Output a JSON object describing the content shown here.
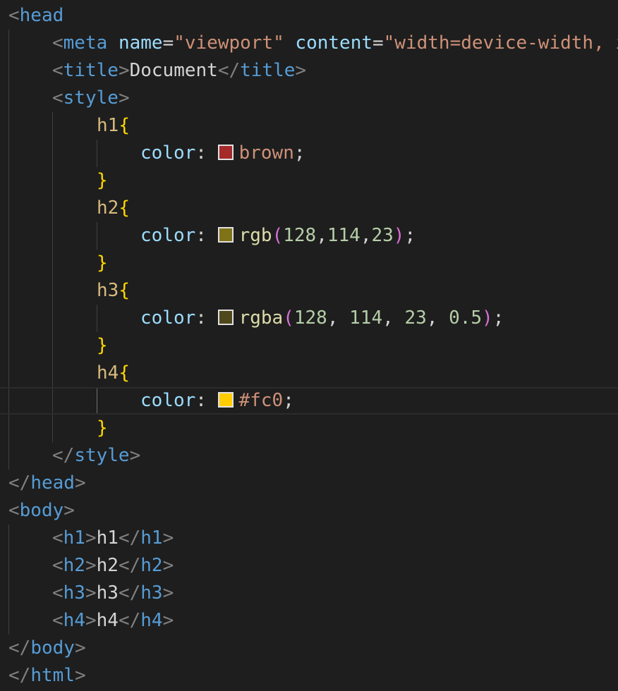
{
  "editor": {
    "lines": [
      {
        "indent": 0,
        "tokens": [
          {
            "t": "<",
            "c": "punct"
          },
          {
            "t": "head",
            "c": "tag"
          }
        ]
      },
      {
        "indent": 4,
        "tokens": [
          {
            "t": "<",
            "c": "punct"
          },
          {
            "t": "meta",
            "c": "tag"
          },
          {
            "t": " ",
            "c": "text"
          },
          {
            "t": "name",
            "c": "attr"
          },
          {
            "t": "=",
            "c": "eq"
          },
          {
            "t": "\"viewport\"",
            "c": "str"
          },
          {
            "t": " ",
            "c": "text"
          },
          {
            "t": "content",
            "c": "attr"
          },
          {
            "t": "=",
            "c": "eq"
          },
          {
            "t": "\"width=device-width, i",
            "c": "str"
          }
        ]
      },
      {
        "indent": 4,
        "tokens": [
          {
            "t": "<",
            "c": "punct"
          },
          {
            "t": "title",
            "c": "tag"
          },
          {
            "t": ">",
            "c": "punct"
          },
          {
            "t": "Document",
            "c": "text"
          },
          {
            "t": "</",
            "c": "punct"
          },
          {
            "t": "title",
            "c": "tag"
          },
          {
            "t": ">",
            "c": "punct"
          }
        ]
      },
      {
        "indent": 4,
        "tokens": [
          {
            "t": "<",
            "c": "punct"
          },
          {
            "t": "style",
            "c": "tag"
          },
          {
            "t": ">",
            "c": "punct"
          }
        ]
      },
      {
        "indent": 8,
        "tokens": [
          {
            "t": "h1",
            "c": "sel"
          },
          {
            "t": "{",
            "c": "brace"
          }
        ]
      },
      {
        "indent": 12,
        "tokens": [
          {
            "t": "color",
            "c": "prop"
          },
          {
            "t": ": ",
            "c": "text"
          },
          {
            "t": "",
            "c": "swatch",
            "color": "#a52a2a"
          },
          {
            "t": "brown",
            "c": "val"
          },
          {
            "t": ";",
            "c": "text"
          }
        ]
      },
      {
        "indent": 8,
        "tokens": [
          {
            "t": "}",
            "c": "brace"
          }
        ]
      },
      {
        "indent": 8,
        "tokens": [
          {
            "t": "h2",
            "c": "sel"
          },
          {
            "t": "{",
            "c": "brace"
          }
        ]
      },
      {
        "indent": 12,
        "tokens": [
          {
            "t": "color",
            "c": "prop"
          },
          {
            "t": ": ",
            "c": "text"
          },
          {
            "t": "",
            "c": "swatch",
            "color": "#807217"
          },
          {
            "t": "rgb",
            "c": "fn"
          },
          {
            "t": "(",
            "c": "paren"
          },
          {
            "t": "128",
            "c": "num"
          },
          {
            "t": ",",
            "c": "text"
          },
          {
            "t": "114",
            "c": "num"
          },
          {
            "t": ",",
            "c": "text"
          },
          {
            "t": "23",
            "c": "num"
          },
          {
            "t": ")",
            "c": "paren"
          },
          {
            "t": ";",
            "c": "text"
          }
        ]
      },
      {
        "indent": 8,
        "tokens": [
          {
            "t": "}",
            "c": "brace"
          }
        ]
      },
      {
        "indent": 8,
        "tokens": [
          {
            "t": "h3",
            "c": "sel"
          },
          {
            "t": "{",
            "c": "brace"
          }
        ]
      },
      {
        "indent": 12,
        "tokens": [
          {
            "t": "color",
            "c": "prop"
          },
          {
            "t": ": ",
            "c": "text"
          },
          {
            "t": "",
            "c": "swatch",
            "color": "#4f481a"
          },
          {
            "t": "rgba",
            "c": "fn"
          },
          {
            "t": "(",
            "c": "paren"
          },
          {
            "t": "128",
            "c": "num"
          },
          {
            "t": ", ",
            "c": "text"
          },
          {
            "t": "114",
            "c": "num"
          },
          {
            "t": ", ",
            "c": "text"
          },
          {
            "t": "23",
            "c": "num"
          },
          {
            "t": ", ",
            "c": "text"
          },
          {
            "t": "0.5",
            "c": "num"
          },
          {
            "t": ")",
            "c": "paren"
          },
          {
            "t": ";",
            "c": "text"
          }
        ]
      },
      {
        "indent": 8,
        "tokens": [
          {
            "t": "}",
            "c": "brace"
          }
        ]
      },
      {
        "indent": 8,
        "tokens": [
          {
            "t": "h4",
            "c": "sel"
          },
          {
            "t": "{",
            "c": "brace"
          }
        ]
      },
      {
        "indent": 12,
        "tokens": [
          {
            "t": "color",
            "c": "prop"
          },
          {
            "t": ": ",
            "c": "text"
          },
          {
            "t": "",
            "c": "swatch",
            "color": "#ffcc00"
          },
          {
            "t": "#fc0",
            "c": "val"
          },
          {
            "t": ";",
            "c": "text"
          }
        ],
        "current": true
      },
      {
        "indent": 8,
        "tokens": [
          {
            "t": "}",
            "c": "brace"
          }
        ]
      },
      {
        "indent": 4,
        "tokens": [
          {
            "t": "</",
            "c": "punct"
          },
          {
            "t": "style",
            "c": "tag"
          },
          {
            "t": ">",
            "c": "punct"
          }
        ]
      },
      {
        "indent": 0,
        "tokens": [
          {
            "t": "</",
            "c": "punct"
          },
          {
            "t": "head",
            "c": "tag"
          },
          {
            "t": ">",
            "c": "punct"
          }
        ]
      },
      {
        "indent": 0,
        "tokens": [
          {
            "t": "<",
            "c": "punct"
          },
          {
            "t": "body",
            "c": "tag"
          },
          {
            "t": ">",
            "c": "punct"
          }
        ]
      },
      {
        "indent": 4,
        "tokens": [
          {
            "t": "<",
            "c": "punct"
          },
          {
            "t": "h1",
            "c": "tag"
          },
          {
            "t": ">",
            "c": "punct"
          },
          {
            "t": "h1",
            "c": "text"
          },
          {
            "t": "</",
            "c": "punct"
          },
          {
            "t": "h1",
            "c": "tag"
          },
          {
            "t": ">",
            "c": "punct"
          }
        ]
      },
      {
        "indent": 4,
        "tokens": [
          {
            "t": "<",
            "c": "punct"
          },
          {
            "t": "h2",
            "c": "tag"
          },
          {
            "t": ">",
            "c": "punct"
          },
          {
            "t": "h2",
            "c": "text"
          },
          {
            "t": "</",
            "c": "punct"
          },
          {
            "t": "h2",
            "c": "tag"
          },
          {
            "t": ">",
            "c": "punct"
          }
        ]
      },
      {
        "indent": 4,
        "tokens": [
          {
            "t": "<",
            "c": "punct"
          },
          {
            "t": "h3",
            "c": "tag"
          },
          {
            "t": ">",
            "c": "punct"
          },
          {
            "t": "h3",
            "c": "text"
          },
          {
            "t": "</",
            "c": "punct"
          },
          {
            "t": "h3",
            "c": "tag"
          },
          {
            "t": ">",
            "c": "punct"
          }
        ]
      },
      {
        "indent": 4,
        "tokens": [
          {
            "t": "<",
            "c": "punct"
          },
          {
            "t": "h4",
            "c": "tag"
          },
          {
            "t": ">",
            "c": "punct"
          },
          {
            "t": "h4",
            "c": "text"
          },
          {
            "t": "</",
            "c": "punct"
          },
          {
            "t": "h4",
            "c": "tag"
          },
          {
            "t": ">",
            "c": "punct"
          }
        ]
      },
      {
        "indent": 0,
        "tokens": [
          {
            "t": "</",
            "c": "punct"
          },
          {
            "t": "body",
            "c": "tag"
          },
          {
            "t": ">",
            "c": "punct"
          }
        ]
      },
      {
        "indent": 0,
        "tokens": [
          {
            "t": "</",
            "c": "punct"
          },
          {
            "t": "html",
            "c": "tag"
          },
          {
            "t": ">",
            "c": "punct"
          }
        ]
      }
    ]
  },
  "colors": {
    "background": "#1e1e1e",
    "tag": "#569cd6",
    "attribute": "#9cdcfe",
    "string": "#ce9178",
    "selector": "#d7ba7d",
    "brace": "#ffd700",
    "paren": "#da70d6",
    "number": "#b5cea8"
  }
}
